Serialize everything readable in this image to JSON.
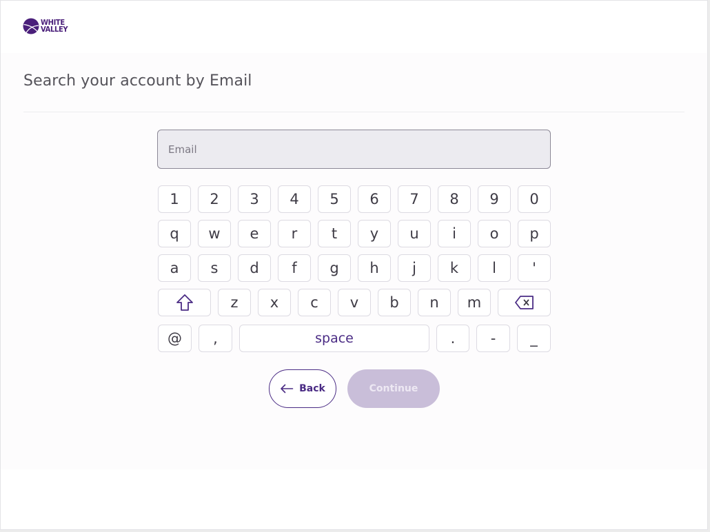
{
  "brand": {
    "name_line1": "WHITE",
    "name_line2": "VALLEY",
    "color": "#4a1f7a"
  },
  "page": {
    "title": "Search your account by Email"
  },
  "search": {
    "value": "",
    "placeholder": "Email"
  },
  "keyboard": {
    "row1": [
      "1",
      "2",
      "3",
      "4",
      "5",
      "6",
      "7",
      "8",
      "9",
      "0"
    ],
    "row2": [
      "q",
      "w",
      "e",
      "r",
      "t",
      "y",
      "u",
      "i",
      "o",
      "p"
    ],
    "row3": [
      "a",
      "s",
      "d",
      "f",
      "g",
      "h",
      "j",
      "k",
      "l",
      "'"
    ],
    "row4": [
      "z",
      "x",
      "c",
      "v",
      "b",
      "n",
      "m"
    ],
    "shift_icon": "shift-arrow-icon",
    "backspace_icon": "backspace-icon",
    "row5": {
      "at": "@",
      "comma": ",",
      "space": "space",
      "period": ".",
      "hyphen": "-",
      "underscore": "_"
    }
  },
  "actions": {
    "back_label": "Back",
    "back_icon": "arrow-left-icon",
    "continue_label": "Continue"
  },
  "colors": {
    "accent": "#4a2b84",
    "continue_disabled_bg": "#c9bed9",
    "text": "#3e3b45"
  }
}
